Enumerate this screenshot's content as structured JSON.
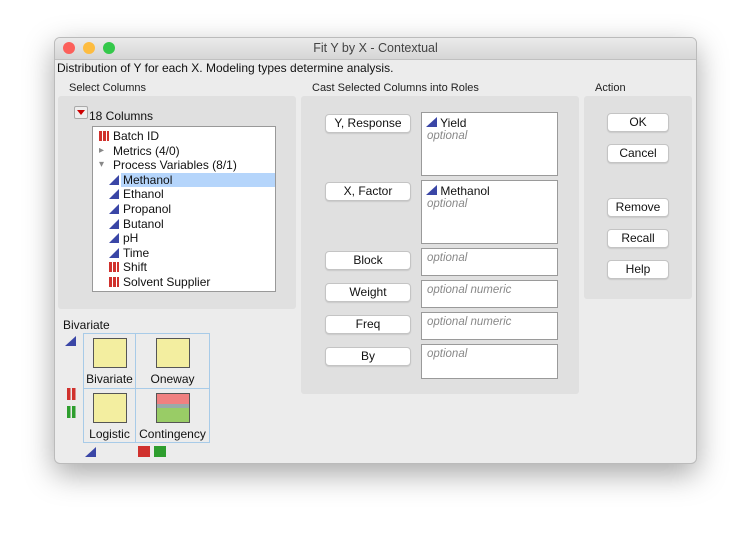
{
  "window": {
    "title": "Fit Y by X - Contextual",
    "subtitle": "Distribution of Y for each X. Modeling types determine analysis."
  },
  "select_columns": {
    "label": "Select Columns",
    "count_label": "18 Columns",
    "items": [
      {
        "label": "Batch ID",
        "icon": "nominal-icon",
        "indent": 0
      },
      {
        "label": "Metrics (4/0)",
        "icon": "disclosure-collapsed-icon",
        "indent": 0
      },
      {
        "label": "Process Variables (8/1)",
        "icon": "disclosure-expanded-icon",
        "indent": 0
      },
      {
        "label": "Methanol",
        "icon": "continuous-icon",
        "indent": 1,
        "selected": true
      },
      {
        "label": "Ethanol",
        "icon": "continuous-icon",
        "indent": 1
      },
      {
        "label": "Propanol",
        "icon": "continuous-icon",
        "indent": 1
      },
      {
        "label": "Butanol",
        "icon": "continuous-icon",
        "indent": 1
      },
      {
        "label": "pH",
        "icon": "continuous-icon",
        "indent": 1
      },
      {
        "label": "Time",
        "icon": "continuous-icon",
        "indent": 1
      },
      {
        "label": "Shift",
        "icon": "nominal-icon",
        "indent": 1
      },
      {
        "label": "Solvent Supplier",
        "icon": "nominal-icon",
        "indent": 1
      }
    ]
  },
  "cast": {
    "label": "Cast Selected Columns into Roles",
    "roles": [
      {
        "button": "Y, Response",
        "value": "Yield",
        "placeholder": "optional"
      },
      {
        "button": "X, Factor",
        "value": "Methanol",
        "placeholder": "optional"
      },
      {
        "button": "Block",
        "placeholder": "optional"
      },
      {
        "button": "Weight",
        "placeholder": "optional numeric"
      },
      {
        "button": "Freq",
        "placeholder": "optional numeric"
      },
      {
        "button": "By",
        "placeholder": "optional"
      }
    ]
  },
  "action": {
    "label": "Action",
    "buttons": [
      "OK",
      "Cancel",
      "Remove",
      "Recall",
      "Help"
    ]
  },
  "analysis": {
    "label": "Bivariate",
    "cells": [
      "Bivariate",
      "Oneway",
      "Logistic",
      "Contingency"
    ]
  },
  "colors": {
    "selection": "#b5d5fb",
    "continuous": "#3a46a6",
    "nominal": "#d0312d",
    "ordinal": "#2e9e2e"
  }
}
